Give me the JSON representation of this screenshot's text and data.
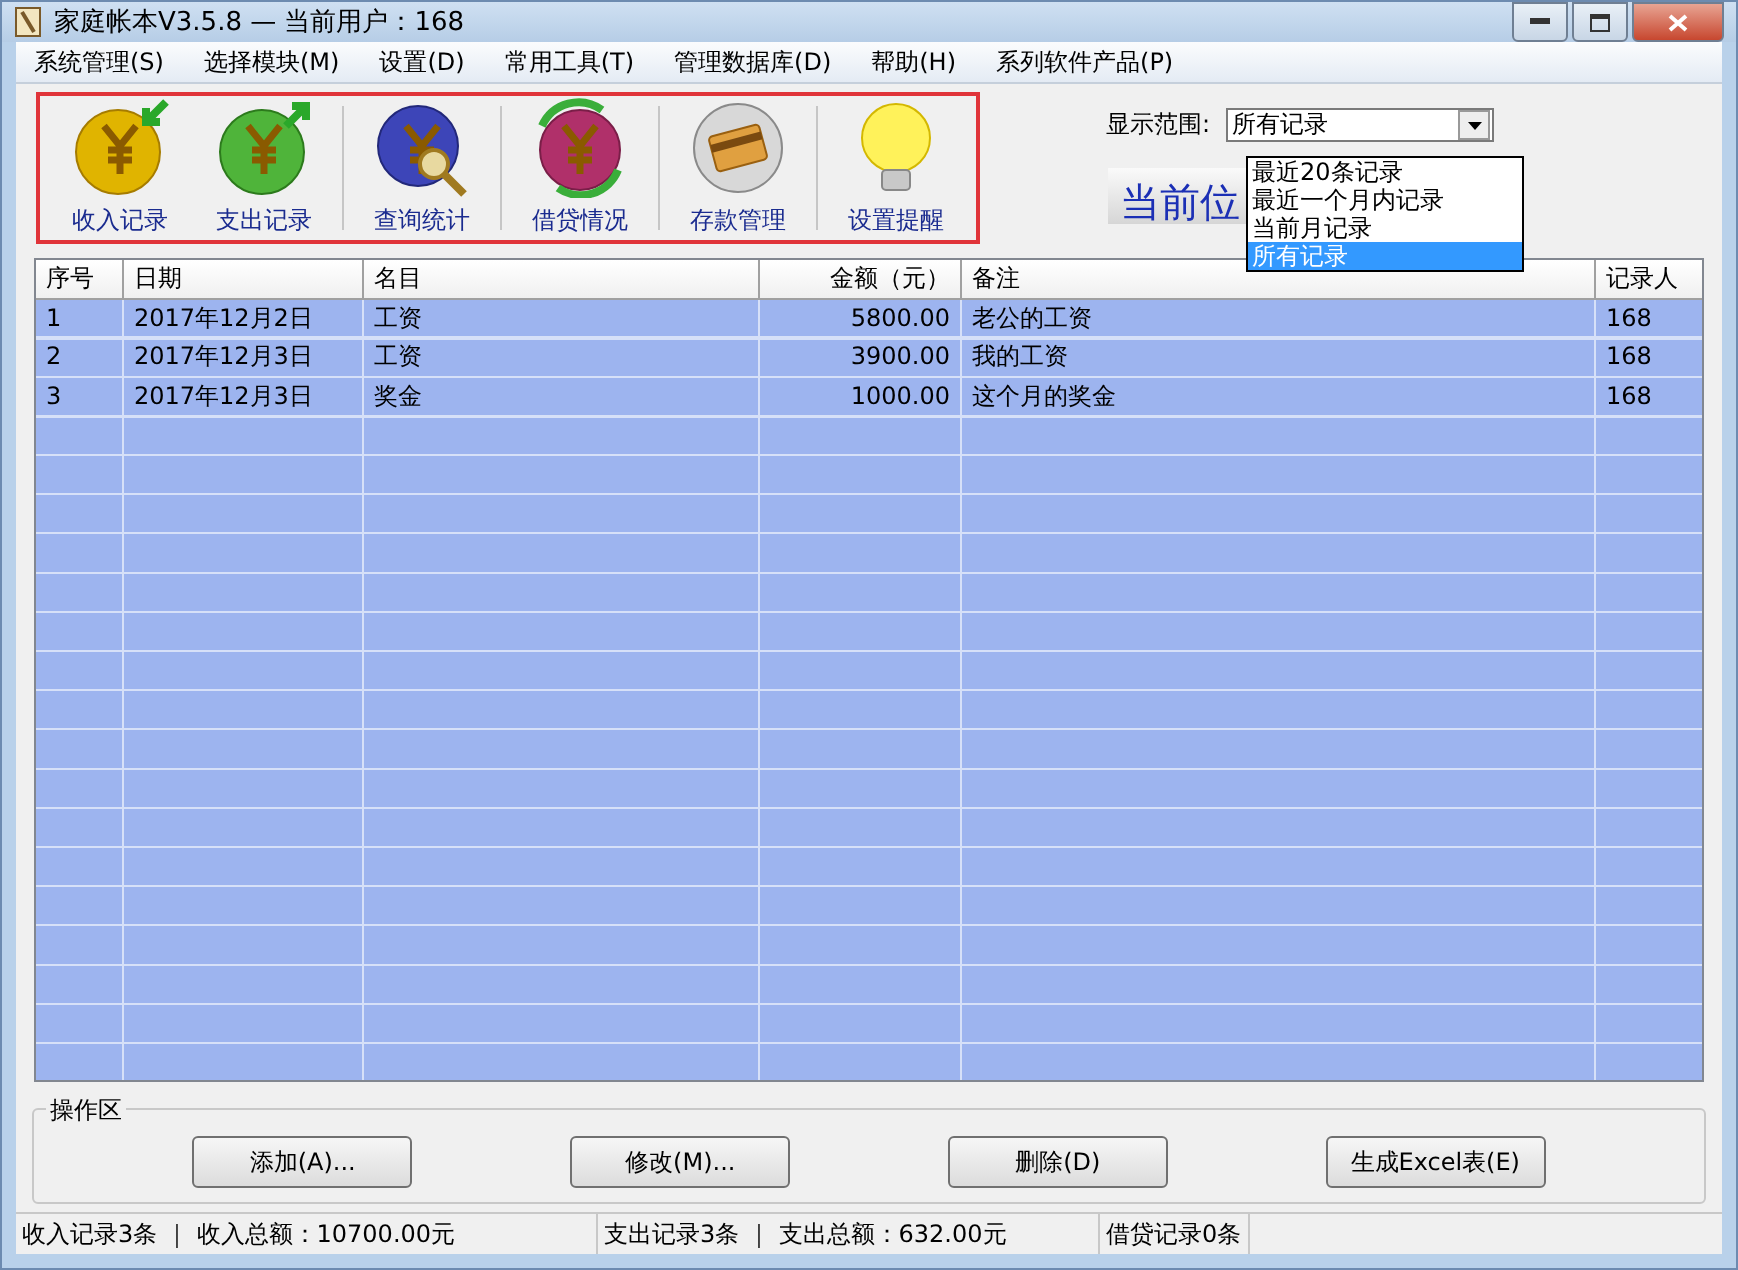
{
  "window": {
    "title": "家庭帐本V3.5.8 — 当前用户：168"
  },
  "menu": [
    "系统管理(S)",
    "选择模块(M)",
    "设置(D)",
    "常用工具(T)",
    "管理数据库(D)",
    "帮助(H)",
    "系列软件产品(P)"
  ],
  "toolbar": [
    {
      "kind": "income",
      "label": "收入记录"
    },
    {
      "kind": "expense",
      "label": "支出记录"
    },
    {
      "kind": "query",
      "label": "查询统计"
    },
    {
      "kind": "loan",
      "label": "借贷情况"
    },
    {
      "kind": "deposit",
      "label": "存款管理"
    },
    {
      "kind": "reminder",
      "label": "设置提醒"
    }
  ],
  "range": {
    "label": "显示范围:",
    "value": "所有记录",
    "options": [
      {
        "label": "最近20条记录",
        "selected": false
      },
      {
        "label": "最近一个月内记录",
        "selected": false
      },
      {
        "label": "当前月记录",
        "selected": false
      },
      {
        "label": "所有记录",
        "selected": true
      }
    ]
  },
  "location_heading": "当前位",
  "table": {
    "columns": [
      "序号",
      "日期",
      "名目",
      "金额（元）",
      "备注",
      "记录人"
    ],
    "rows": [
      [
        "1",
        "2017年12月2日",
        "工资",
        "5800.00",
        "老公的工资",
        "168"
      ],
      [
        "2",
        "2017年12月3日",
        "工资",
        "3900.00",
        "我的工资",
        "168"
      ],
      [
        "3",
        "2017年12月3日",
        "奖金",
        "1000.00",
        "这个月的奖金",
        "168"
      ]
    ]
  },
  "operations": {
    "title": "操作区",
    "buttons": [
      "添加(A)...",
      "修改(M)...",
      "删除(D)",
      "生成Excel表(E)"
    ]
  },
  "status_bar": [
    "收入记录3条 ｜ 收入总额：10700.00元",
    "支出记录3条 ｜ 支出总额：632.00元",
    "借贷记录0条"
  ]
}
